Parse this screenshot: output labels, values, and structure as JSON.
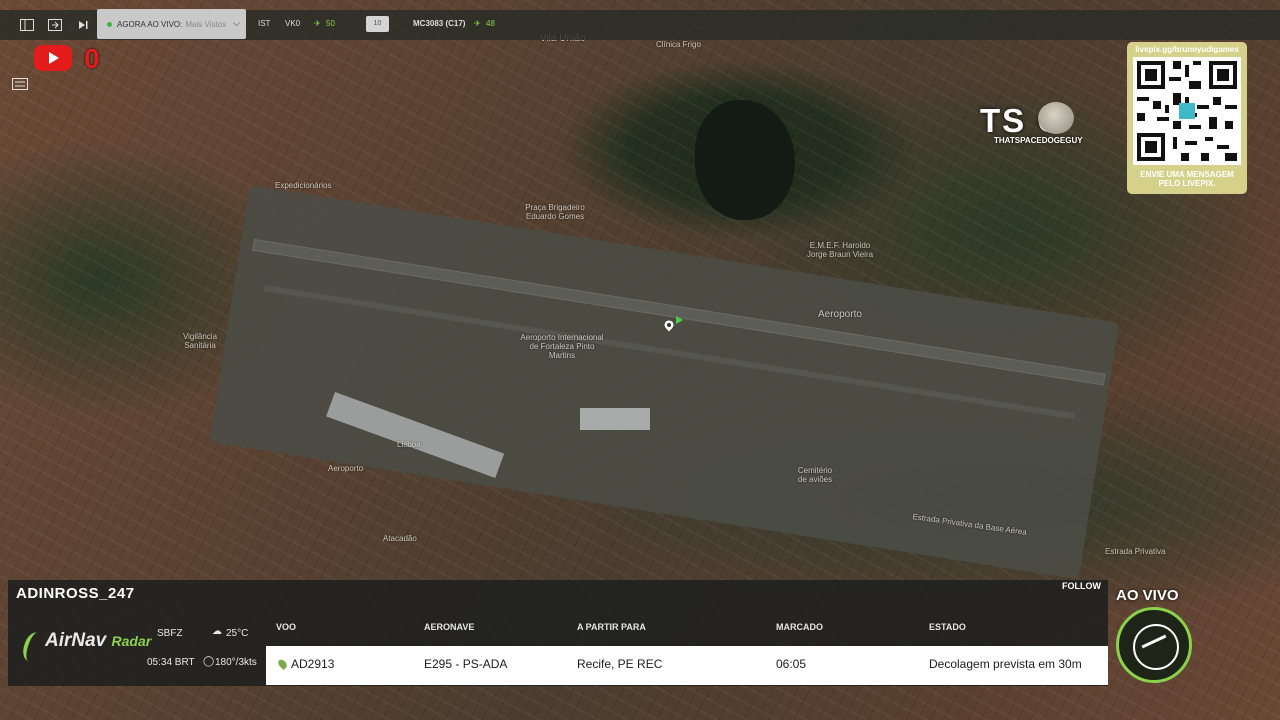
{
  "toolbar": {
    "mode_dot_color": "#39b939",
    "live_label": "AGORA AO VIVO:",
    "live_sort": "Mais Vistos",
    "item_ist": "IST",
    "item_vk": "VK0",
    "count_a": "50",
    "badge": "10",
    "flight_code": "MC3083 (C17)",
    "count_b": "48"
  },
  "youtube": {
    "count": "0"
  },
  "branding": {
    "logo_text": "TS G",
    "logo_sub": "THATSPACEDOGEGUY",
    "qr_top": "livepix.gg/brunoyudigames",
    "qr_bottom_1": "ENVIE UMA MENSAGEM",
    "qr_bottom_2": "PELO LIVEPIX."
  },
  "map": {
    "labels": {
      "expedicionarios": "Expedicionários",
      "praca": "Praça Brigadeiro Eduardo Gomes",
      "aeroporto_internacional": "Aeroporto Internacional de Fortaleza Pinto Martins",
      "aeroporto": "Aeroporto",
      "emef": "E.M.E.F. Haroldo Jorge Braun Vieira",
      "vigilancia": "Vigilância Sanitária",
      "aeroporto2": "Aeroporto",
      "cemiterio": "Cemitério de aviões",
      "estrada": "Estrada Privativa da Base Aérea",
      "estrada2": "Estrada Privativa",
      "atacadao": "Atacadão",
      "lisboa": "Lisboa",
      "vila_uniao": "Vila União",
      "clinica": "Clínica Frigo"
    }
  },
  "flight_panel": {
    "callsign": "ADINROSS_247",
    "follow": "FOLLOW",
    "brand_air": "AirNav",
    "brand_radar": "Radar",
    "airport": "SBFZ",
    "time": "05:34 BRT",
    "temperature": "25°C",
    "wind": "180°/3kts",
    "headers": {
      "voo": "VOO",
      "aeronave": "AERONAVE",
      "partir": "A PARTIR PARA",
      "marcado": "MARCADO",
      "estado": "ESTADO"
    },
    "row": {
      "voo": "AD2913",
      "aeronave": "E295 - PS-ADA",
      "partir": "Recife, PE REC",
      "marcado": "06:05",
      "estado": "Decolagem prevista em 30m"
    }
  },
  "overlay": {
    "ao_vivo": "AO VIVO"
  },
  "colors": {
    "accent_green": "#8bd14c",
    "youtube_red": "#e31b1b",
    "panel_bg": "#1c1f1d"
  },
  "icons": [
    "sidebar-collapse-icon",
    "fullscreen-icon",
    "skip-icon",
    "chevron-down-icon",
    "list-icon",
    "youtube-icon",
    "map-pin-icon",
    "plane-icon",
    "cloud-icon",
    "wind-icon"
  ]
}
